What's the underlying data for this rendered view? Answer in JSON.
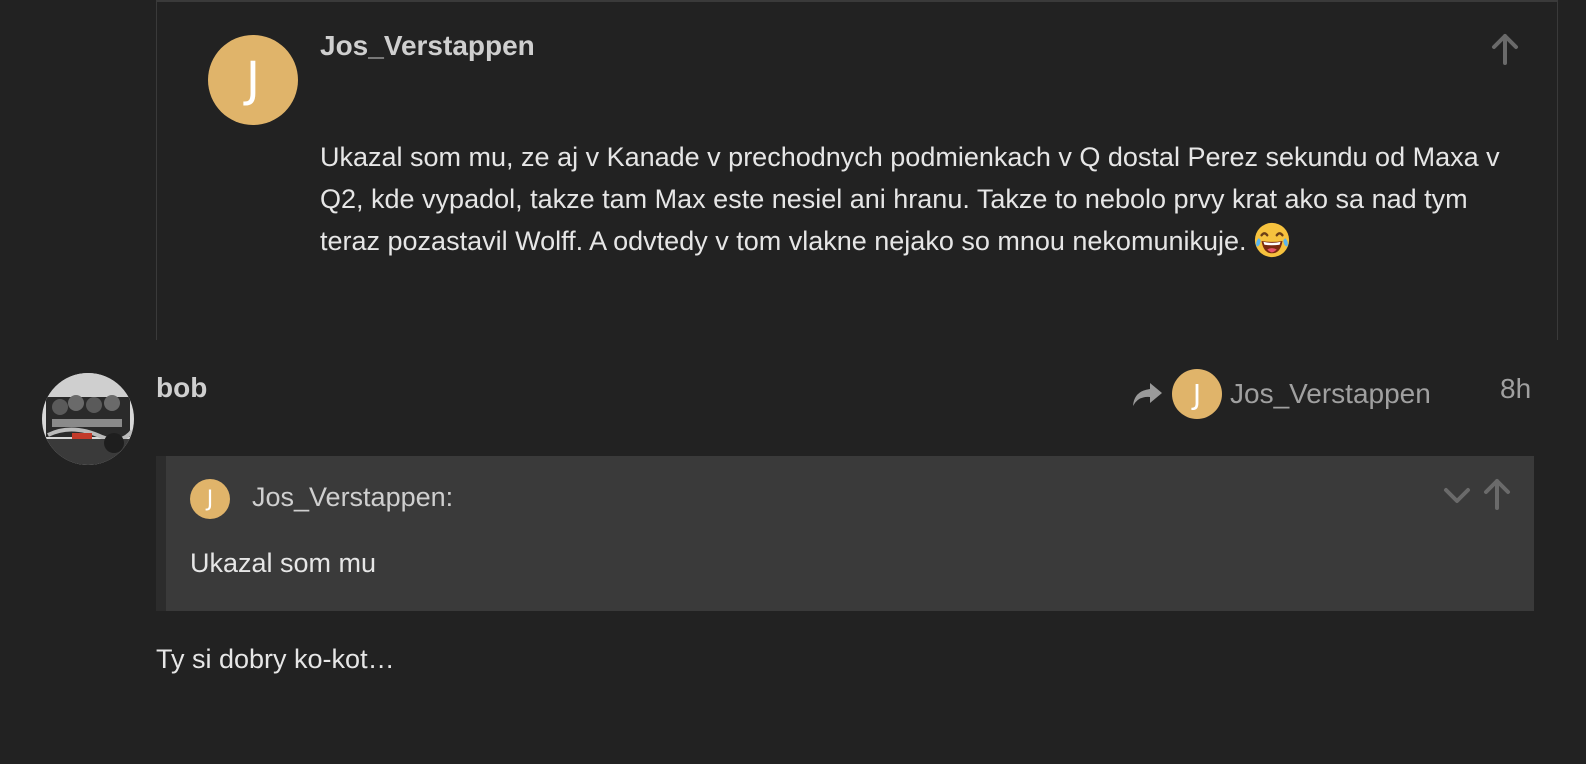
{
  "embedded_post": {
    "avatar_letter": "J",
    "username": "Jos_Verstappen",
    "body": "Ukazal som mu, ze aj v Kanade v prechodnych podmienkach v Q dostal Perez sekundu od Maxa v Q2, kde vypadol, takze tam Max este nesiel ani hranu. Takze to nebolo prvy krat ako sa nad tym teraz pozastavil Wolff. A odvtedy v tom vlakne nejako so mnou nekomunikuje.",
    "emoji": "face-with-tears-of-joy",
    "avatar_color": "#e0b46a"
  },
  "post": {
    "username": "bob",
    "reply_to": {
      "avatar_letter": "J",
      "username": "Jos_Verstappen"
    },
    "date": "8h",
    "quote": {
      "avatar_letter": "J",
      "author": "Jos_Verstappen:",
      "text": "Ukazal som mu"
    },
    "body": "Ty si dobry ko-kot…"
  }
}
